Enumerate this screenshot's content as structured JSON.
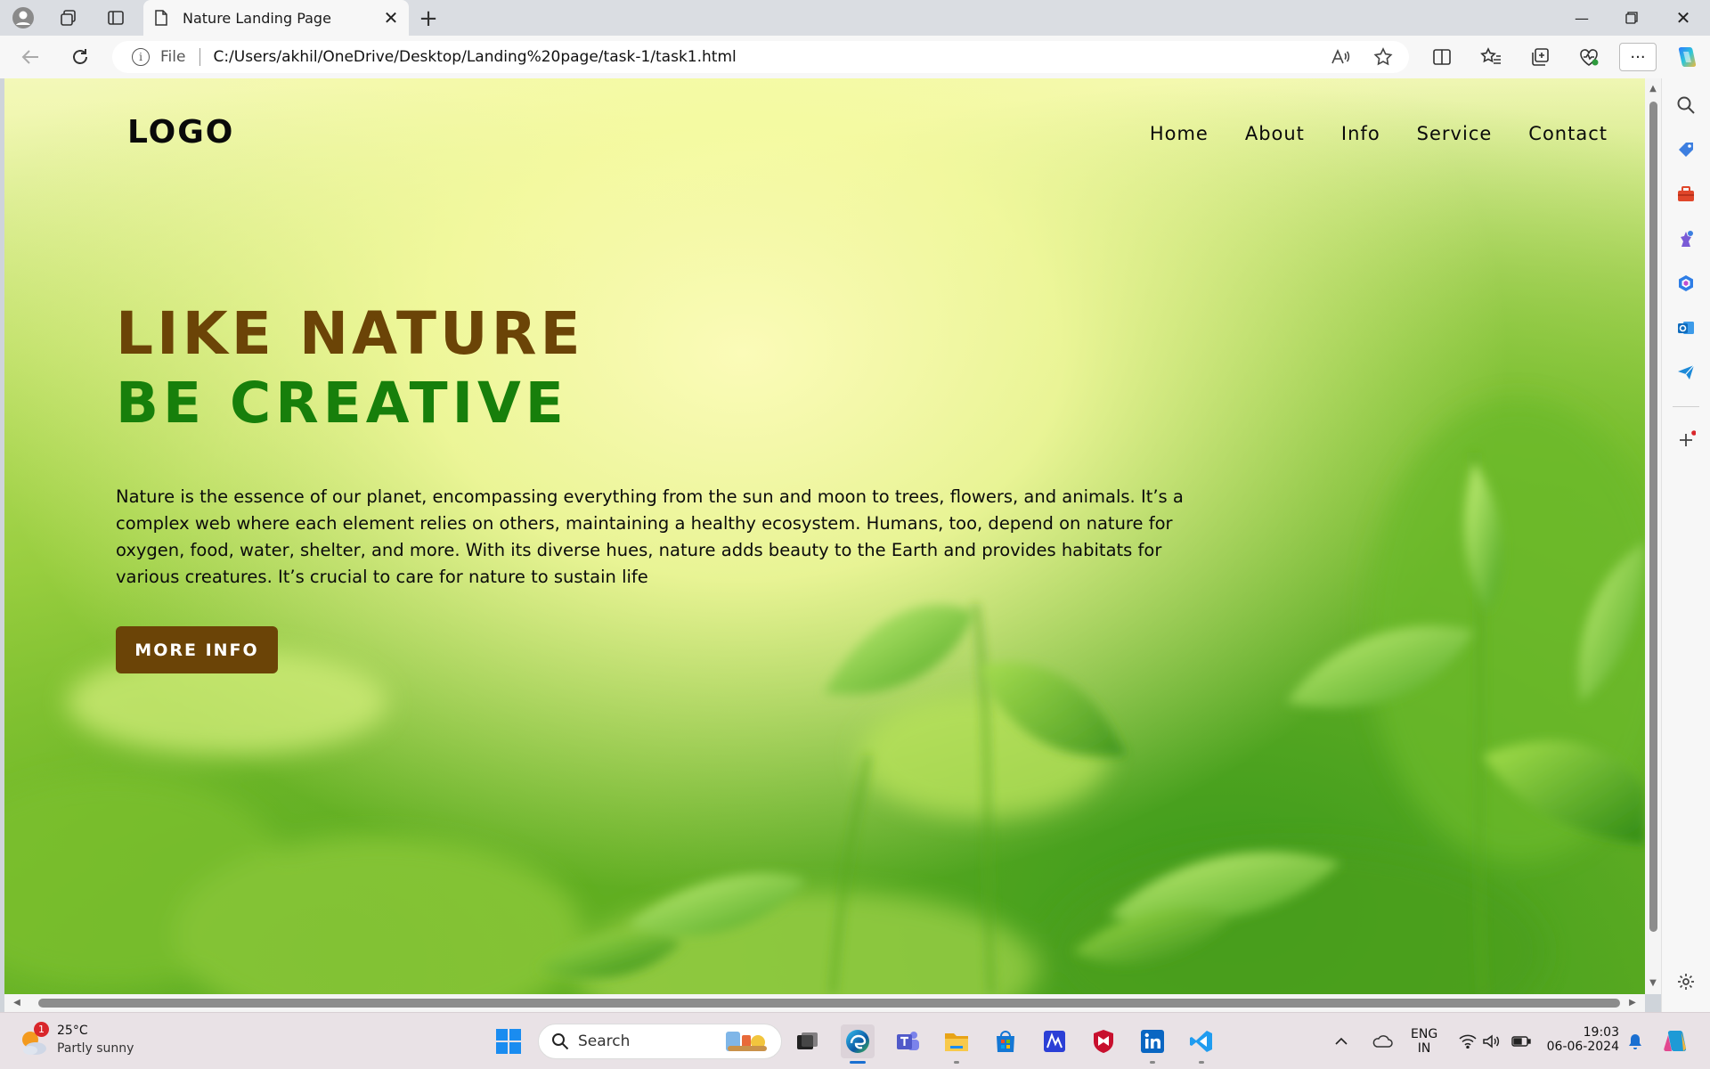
{
  "browser": {
    "tab_title": "Nature Landing Page",
    "address_scheme": "File",
    "address_url": "C:/Users/akhil/OneDrive/Desktop/Landing%20page/task-1/task1.html",
    "more_label": "···"
  },
  "page": {
    "logo": "LOGO",
    "nav": [
      "Home",
      "About",
      "Info",
      "Service",
      "Contact"
    ],
    "headline_1": "LIKE NATURE",
    "headline_2": "BE CREATIVE",
    "description": "Nature is the essence of our planet, encompassing everything from the sun and moon to trees, flowers, and animals. It’s a complex web where each element relies on others, maintaining a healthy ecosystem. Humans, too, depend on nature for oxygen, food, water, shelter, and more. With its diverse hues, nature adds beauty to the Earth and provides habitats for various creatures. It’s crucial to care for nature to sustain life",
    "cta_label": "MORE INFO",
    "colors": {
      "headline_1": "#6b4407",
      "headline_2": "#177f0b",
      "cta_bg": "#6b4407"
    }
  },
  "taskbar": {
    "weather_badge": "1",
    "weather_temp": "25°C",
    "weather_desc": "Partly sunny",
    "search_label": "Search",
    "lang_1": "ENG",
    "lang_2": "IN",
    "time": "19:03",
    "date": "06-06-2024"
  }
}
